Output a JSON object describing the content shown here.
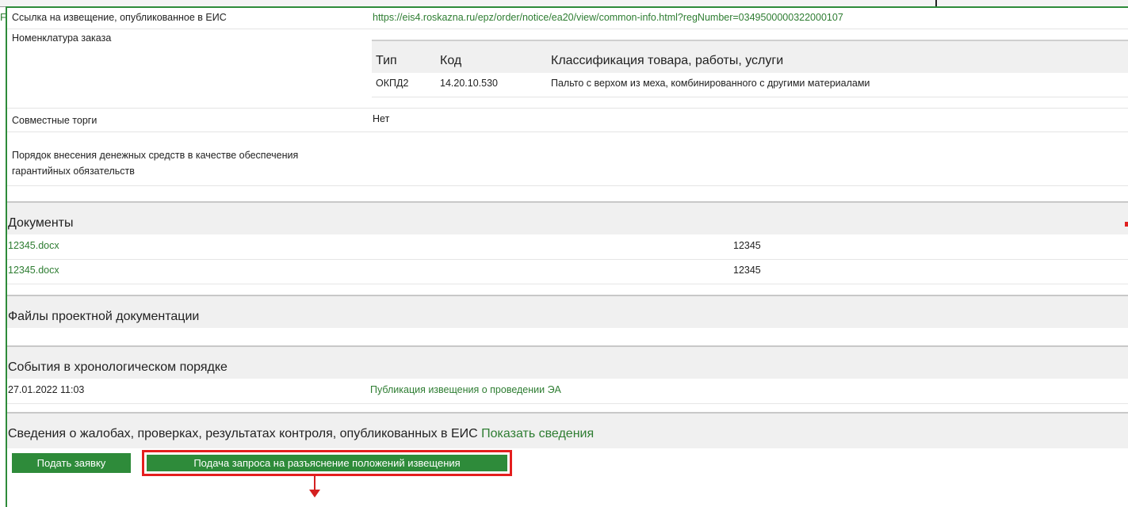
{
  "stray": "F",
  "notice_link": {
    "label": "Ссылка на извещение, опубликованное в ЕИС",
    "url": "https://eis4.roskazna.ru/epz/order/notice/ea20/view/common-info.html?regNumber=0349500000322000107"
  },
  "nomenclature": {
    "label": "Номенклатура заказа",
    "headers": {
      "type": "Тип",
      "code": "Код",
      "classification": "Классификация товара, работы, услуги"
    },
    "rows": [
      {
        "type": "ОКПД2",
        "code": "14.20.10.530",
        "classification": "Пальто с верхом из меха, комбинированного с другими материалами"
      }
    ]
  },
  "joint_bidding": {
    "label": "Совместные торги",
    "value": "Нет"
  },
  "guarantee": {
    "label_line1": "Порядок внесения денежных средств в качестве обеспечения",
    "label_line2": "гарантийных обязательств"
  },
  "documents": {
    "title": "Документы",
    "items": [
      {
        "name": "12345.docx",
        "value": "12345"
      },
      {
        "name": "12345.docx",
        "value": "12345"
      }
    ]
  },
  "project_files": {
    "title": "Файлы проектной документации"
  },
  "events": {
    "title": "События в хронологическом порядке",
    "items": [
      {
        "date": "27.01.2022 11:03",
        "text": "Публикация извещения о проведении ЭА"
      }
    ]
  },
  "complaints": {
    "title": "Сведения о жалобах, проверках, результатах контроля, опубликованных в ЕИС",
    "link": "Показать сведения"
  },
  "buttons": {
    "submit": "Подать заявку",
    "clarification": "Подача запроса на разъяснение положений извещения"
  },
  "colors": {
    "accent": "#2e8b3a",
    "highlight": "#e41e1e"
  }
}
